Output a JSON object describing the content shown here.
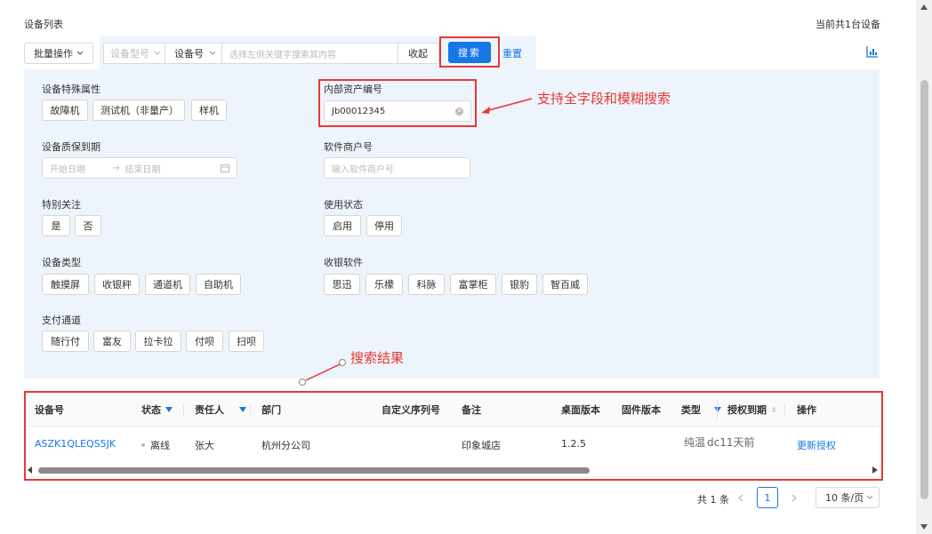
{
  "header": {
    "title": "设备列表",
    "count_text": "当前共1台设备"
  },
  "toolbar": {
    "batch_label": "批量操作",
    "model_placeholder": "设备型号",
    "field_selected": "设备号",
    "keyword_placeholder": "选择左侧关键字搜索其内容",
    "collapse_label": "收起",
    "search_label": "搜索",
    "reset_label": "重置"
  },
  "filters": {
    "special_attr": {
      "label": "设备特殊属性",
      "tags": [
        "故障机",
        "测试机（非量产）",
        "样机"
      ]
    },
    "asset_no": {
      "label": "内部资产编号",
      "value": "Jb00012345"
    },
    "warranty": {
      "label": "设备质保到期",
      "start_placeholder": "开始日期",
      "end_placeholder": "结束日期"
    },
    "merchant": {
      "label": "软件商户号",
      "placeholder": "输入软件商户号"
    },
    "attention": {
      "label": "特别关注",
      "tags": [
        "是",
        "否"
      ]
    },
    "usage": {
      "label": "使用状态",
      "tags": [
        "启用",
        "停用"
      ]
    },
    "device_type": {
      "label": "设备类型",
      "tags": [
        "触摸屏",
        "收银秤",
        "通道机",
        "自助机"
      ]
    },
    "pos_software": {
      "label": "收银软件",
      "tags": [
        "思迅",
        "乐檬",
        "科脉",
        "富掌柜",
        "银豹",
        "智百威"
      ]
    },
    "payment": {
      "label": "支付通道",
      "tags": [
        "随行付",
        "富友",
        "拉卡拉",
        "付呗",
        "扫呗"
      ]
    }
  },
  "annotations": {
    "search_support": "支持全字段和模糊搜索",
    "search_result": "搜索结果"
  },
  "table": {
    "columns": [
      "设备号",
      "状态",
      "责任人",
      "部门",
      "自定义序列号",
      "备注",
      "桌面版本",
      "固件版本",
      "类型",
      "授权到期",
      "操作"
    ],
    "rows": [
      {
        "device_no": "ASZK1QLEQS5JK",
        "status": "离线",
        "owner": "张大",
        "dept": "杭州分公司",
        "serial": "",
        "remark": "印象城店",
        "desktop_ver": "1.2.5",
        "firmware_ver": "",
        "type": "纯温",
        "expire": "dc11天前",
        "action": "更新授权"
      }
    ]
  },
  "pagination": {
    "total": "共 1 条",
    "current": "1",
    "page_size": "10 条/页"
  },
  "colors": {
    "accent": "#1677e5",
    "annotation": "#e53935",
    "panel": "#eef4fb"
  }
}
